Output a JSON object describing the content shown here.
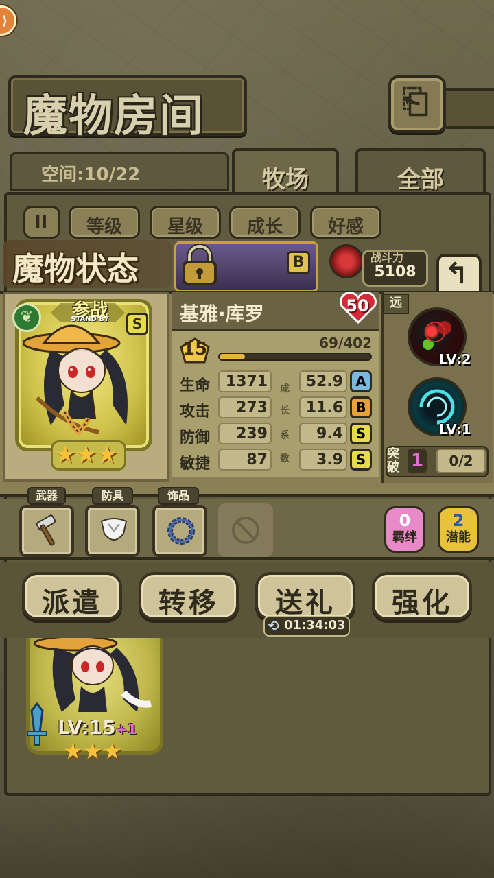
{
  "header": {
    "title": "魔物房间",
    "back_glyph": "⎗",
    "menu_glyph": "⟩"
  },
  "tabs": {
    "space_label": "空间:10/22",
    "items": [
      {
        "label": "牧场"
      },
      {
        "label": "全部"
      }
    ]
  },
  "sort": {
    "pause_glyph": "II",
    "buttons": [
      {
        "label": "等级"
      },
      {
        "label": "星级"
      },
      {
        "label": "成长"
      },
      {
        "label": "好感"
      }
    ]
  },
  "status": {
    "title": "魔物状态",
    "locked_card_grade": "B",
    "power_label": "战斗力",
    "power_value": "5108",
    "return_glyph": "↰"
  },
  "monster": {
    "standby_main": "参战",
    "standby_sub": "STAND BY",
    "grade": "S",
    "stars": "★★★",
    "name": "基雅·库罗",
    "affection": "50",
    "level": "15",
    "exp_text": "69/402",
    "exp_fraction": 0.17,
    "stats": [
      {
        "label": "生命",
        "value": "1371",
        "growth": "52.9",
        "grade": "A"
      },
      {
        "label": "攻击",
        "value": "273",
        "growth": "11.6",
        "grade": "B"
      },
      {
        "label": "防御",
        "value": "239",
        "growth": "9.4",
        "grade": "S"
      },
      {
        "label": "敏捷",
        "value": "87",
        "growth": "3.9",
        "grade": "S"
      }
    ],
    "growth_chars": [
      "成",
      "长",
      "系",
      "数"
    ]
  },
  "skills": {
    "range": "远",
    "items": [
      {
        "lv": "LV:2"
      },
      {
        "lv": "LV:1"
      }
    ],
    "break_label": "突破",
    "break_count": "1",
    "break_progress": "0/2"
  },
  "equipment": {
    "slots": [
      {
        "tag": "武器",
        "icon": "hammer-icon"
      },
      {
        "tag": "防具",
        "icon": "armor-icon"
      },
      {
        "tag": "饰品",
        "icon": "bracelet-icon"
      }
    ],
    "bond": {
      "num": "0",
      "label": "羁绊"
    },
    "potential": {
      "num": "2",
      "label": "潜能"
    }
  },
  "actions": [
    {
      "label": "派遣"
    },
    {
      "label": "转移"
    },
    {
      "label": "送礼"
    },
    {
      "label": "强化"
    }
  ],
  "timer": "01:34:03",
  "timer_glyph": "⟲",
  "bottom_card": {
    "lv": "LV:15",
    "plus": "+1",
    "stars": "★★★"
  }
}
